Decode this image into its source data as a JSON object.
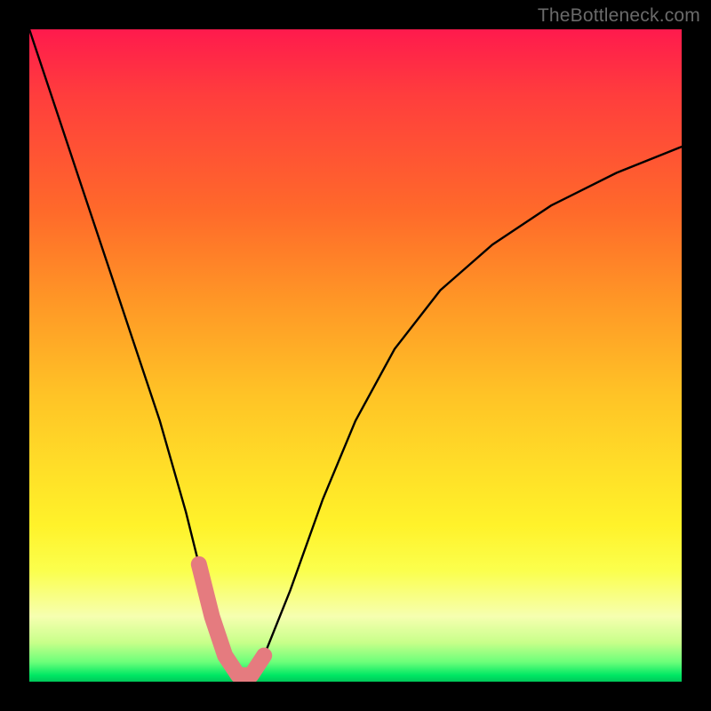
{
  "attribution": "TheBottleneck.com",
  "colors": {
    "background_black": "#000000",
    "gradient_top": "#ff1a4d",
    "gradient_mid_orange": "#ff9826",
    "gradient_mid_yellow": "#ffe028",
    "gradient_bottom_green": "#00c85a",
    "curve_black": "#000000",
    "overlay_pink": "#e57b7f"
  },
  "chart_data": {
    "type": "line",
    "title": "",
    "xlabel": "",
    "ylabel": "",
    "xlim": [
      0,
      100
    ],
    "ylim": [
      0,
      100
    ],
    "grid": false,
    "legend": null,
    "series": [
      {
        "name": "bottleneck-curve",
        "x": [
          0,
          4,
          8,
          12,
          16,
          20,
          24,
          26,
          28,
          30,
          32,
          34,
          36,
          40,
          45,
          50,
          56,
          63,
          71,
          80,
          90,
          100
        ],
        "values": [
          100,
          88,
          76,
          64,
          52,
          40,
          26,
          18,
          10,
          4,
          1,
          1,
          4,
          14,
          28,
          40,
          51,
          60,
          67,
          73,
          78,
          82
        ]
      }
    ],
    "overlay_marker": {
      "description": "pink U-shaped highlight at curve minimum",
      "x_range": [
        25,
        36
      ],
      "y_range": [
        0,
        12
      ],
      "color": "#e57b7f"
    }
  }
}
